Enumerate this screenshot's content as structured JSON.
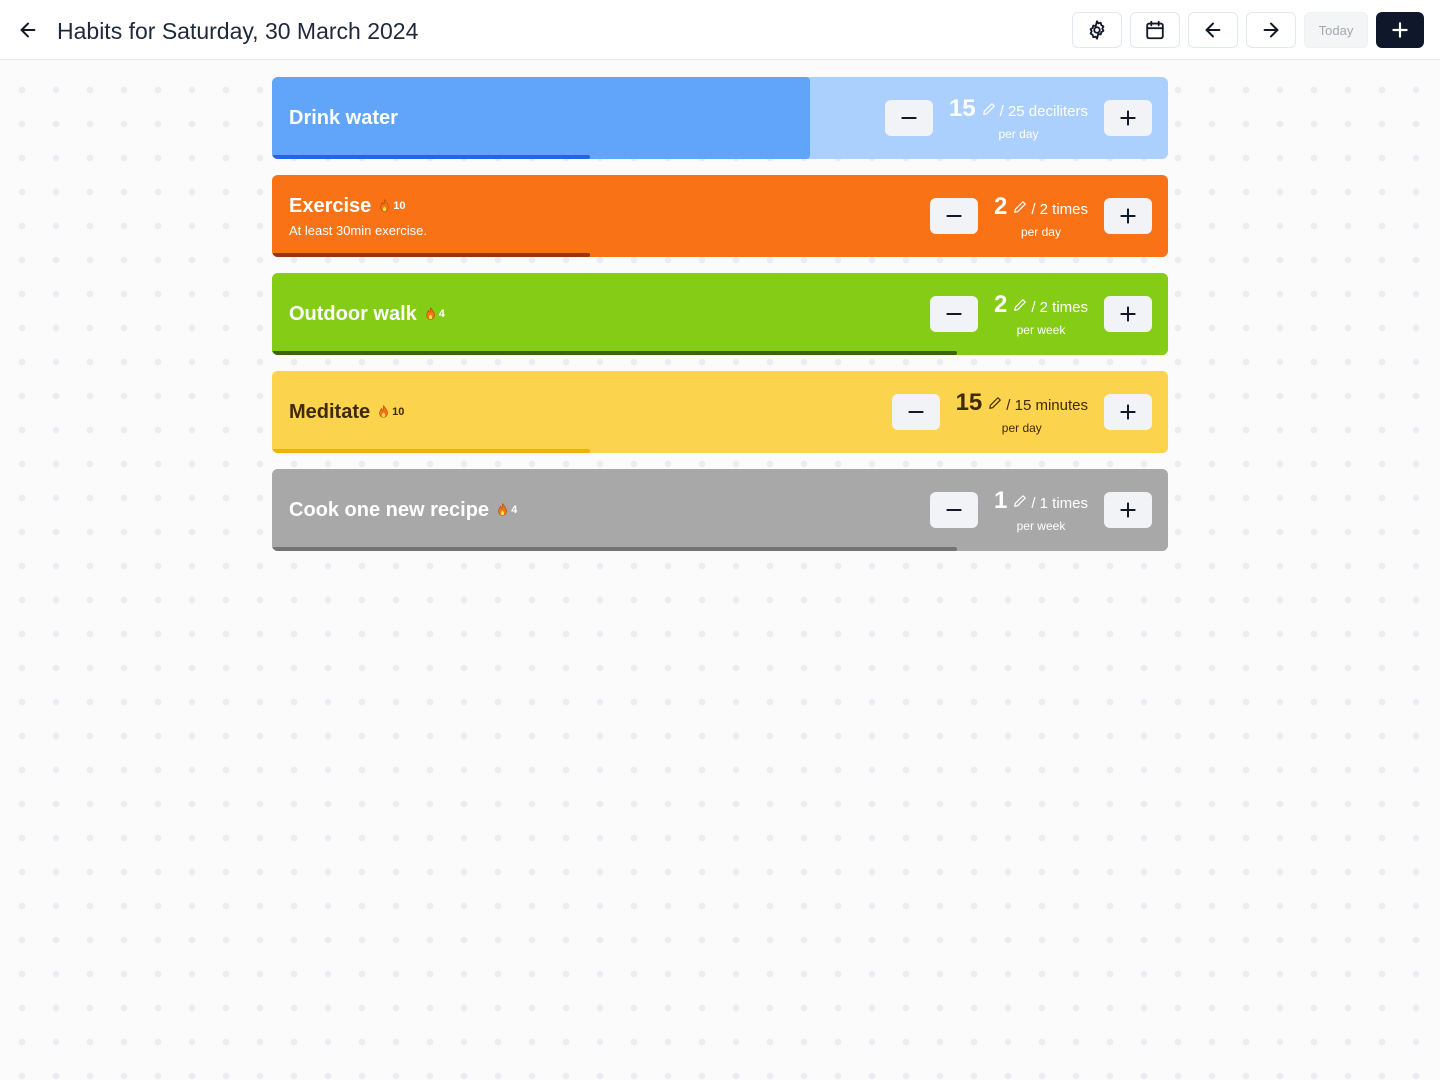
{
  "header": {
    "title": "Habits for Saturday, 30 March 2024",
    "back_icon": "arrow-left-icon",
    "buttons": {
      "settings_icon": "gear-icon",
      "calendar_icon": "calendar-icon",
      "previous_icon": "arrow-left-icon",
      "next_icon": "arrow-right-icon",
      "today_label": "Today",
      "add_icon": "plus-icon"
    }
  },
  "habits": [
    {
      "name": "Drink water",
      "streak": "",
      "description": "",
      "count": "15",
      "target": "/ 25 deciliters",
      "period": "per day",
      "progress": 0.6,
      "colors": {
        "fill": "#60a5fa",
        "background": "#acd0fd",
        "bar": "#2563eb",
        "text": "#ffffff"
      }
    },
    {
      "name": "Exercise",
      "streak": "10",
      "description": "At least 30min exercise.",
      "count": "2",
      "target": "/ 2 times",
      "period": "per day",
      "progress": 1.0,
      "colors": {
        "fill": "#f97316",
        "background": "#f97316",
        "bar": "#9a3412",
        "text": "#ffffff"
      }
    },
    {
      "name": "Outdoor walk",
      "streak": "4",
      "description": "",
      "count": "2",
      "target": "/ 2 times",
      "period": "per week",
      "progress": 1.0,
      "colors": {
        "fill": "#84cc16",
        "background": "#84cc16",
        "bar": "#3f6212",
        "text": "#ffffff"
      }
    },
    {
      "name": "Meditate",
      "streak": "10",
      "description": "",
      "count": "15",
      "target": "/ 15 minutes",
      "period": "per day",
      "progress": 1.0,
      "colors": {
        "fill": "#fcd34d",
        "background": "#fcd34d",
        "bar": "#eab308",
        "text": "#3f2a08"
      }
    },
    {
      "name": "Cook one new recipe",
      "streak": "4",
      "description": "",
      "count": "1",
      "target": "/ 1 times",
      "period": "per week",
      "progress": 1.0,
      "colors": {
        "fill": "#a8a8a8",
        "background": "#a8a8a8",
        "bar": "#737373",
        "text": "#ffffff"
      }
    }
  ],
  "card_icons": {
    "streak_icon": "fire-icon",
    "edit_icon": "pencil-icon",
    "decrement_icon": "minus-icon",
    "increment_icon": "plus-icon"
  }
}
